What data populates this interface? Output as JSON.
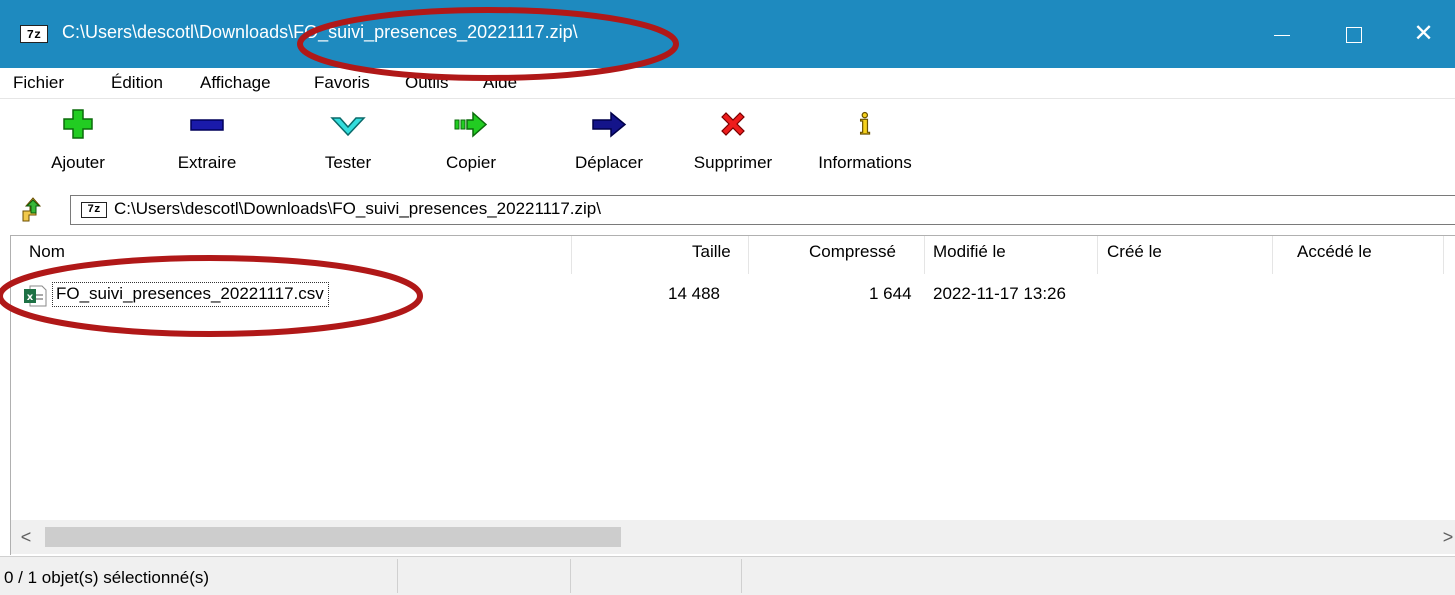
{
  "window": {
    "title": "C:\\Users\\descotl\\Downloads\\FO_suivi_presences_20221117.zip\\",
    "app_icon_text": "7z",
    "close_glyph": "✕"
  },
  "menu": {
    "items": [
      "Fichier",
      "Édition",
      "Affichage",
      "Favoris",
      "Outils",
      "Aide"
    ]
  },
  "toolbar": {
    "add_label": "Ajouter",
    "extract_label": "Extraire",
    "test_label": "Tester",
    "copy_label": "Copier",
    "move_label": "Déplacer",
    "delete_label": "Supprimer",
    "info_label": "Informations",
    "info_glyph": "i"
  },
  "address": {
    "icon_text": "7z",
    "path": "C:\\Users\\descotl\\Downloads\\FO_suivi_presences_20221117.zip\\"
  },
  "columns": {
    "name": "Nom",
    "size": "Taille",
    "packed": "Compressé",
    "modified": "Modifié le",
    "created": "Créé le",
    "accessed": "Accédé le"
  },
  "files": [
    {
      "name": "FO_suivi_presences_20221117.csv",
      "size": "14 488",
      "packed": "1 644",
      "modified": "2022-11-17 13:26",
      "created": "",
      "accessed": ""
    }
  ],
  "scrollbar": {
    "left_arrow": "<",
    "right_arrow": ">"
  },
  "status": {
    "selection": "0 / 1 objet(s) sélectionné(s)"
  },
  "colors": {
    "titlebar": "#1e8abf",
    "annotation": "#b01818"
  }
}
